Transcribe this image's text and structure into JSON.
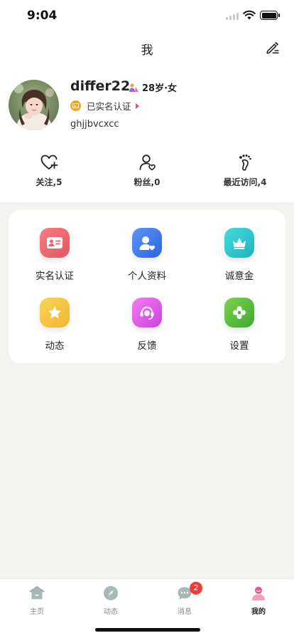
{
  "status_bar": {
    "time": "9:04"
  },
  "nav": {
    "title": "我",
    "edit_icon": "edit-icon"
  },
  "profile": {
    "nickname": "differ22",
    "age_gender": "28岁·女",
    "verified_label": "已实名认证",
    "signature": "ghjjbvcxcc"
  },
  "stats": [
    {
      "label": "关注,5",
      "icon": "heart-plus-icon"
    },
    {
      "label": "粉丝,0",
      "icon": "person-heart-icon"
    },
    {
      "label": "最近访问,4",
      "icon": "footprint-icon"
    }
  ],
  "menu": [
    {
      "label": "实名认证",
      "icon": "id-card-icon",
      "color": "#ef6a7a"
    },
    {
      "label": "个人资料",
      "icon": "profile-icon",
      "color": "#3f7df0"
    },
    {
      "label": "诚意金",
      "icon": "crown-icon",
      "color": "#28c7cf"
    },
    {
      "label": "动态",
      "icon": "star-icon",
      "color": "#f7c441"
    },
    {
      "label": "反馈",
      "icon": "feedback-icon",
      "color": "#e358e8"
    },
    {
      "label": "设置",
      "icon": "gear-icon",
      "color": "#58bd3c"
    }
  ],
  "tabs": [
    {
      "label": "主页",
      "icon": "home-icon"
    },
    {
      "label": "动态",
      "icon": "compass-icon"
    },
    {
      "label": "消息",
      "icon": "message-icon",
      "badge": "2"
    },
    {
      "label": "我的",
      "icon": "me-icon",
      "active": true
    }
  ]
}
